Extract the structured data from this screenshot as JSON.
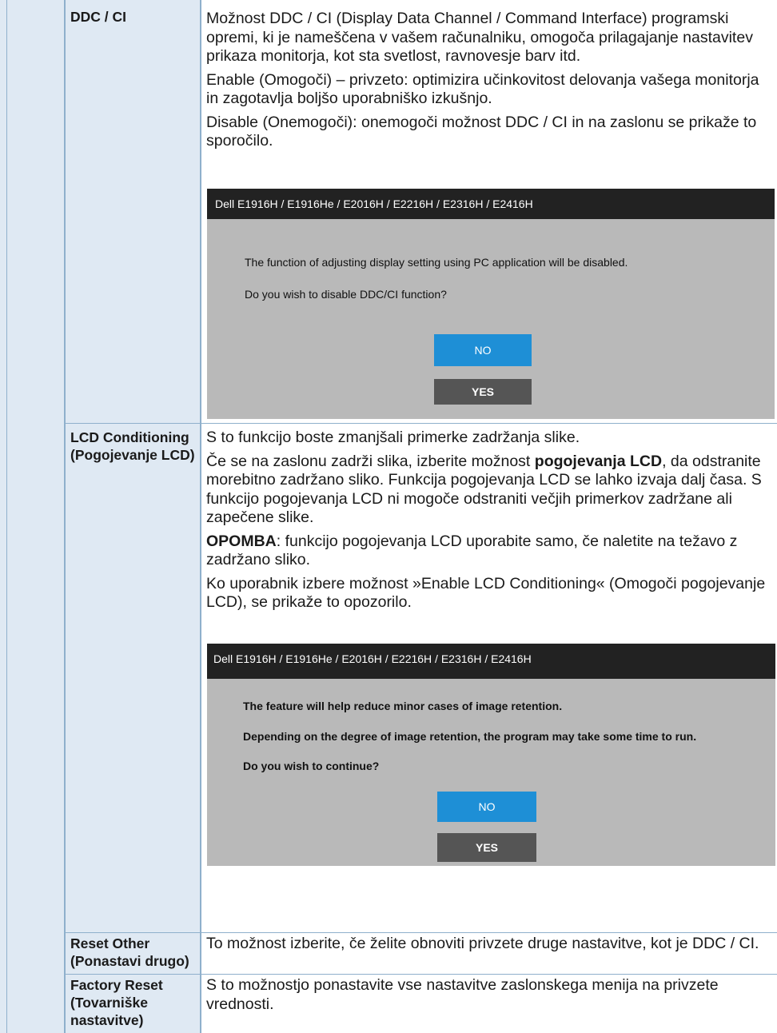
{
  "rows": [
    {
      "name": "DDC / CI",
      "paragraphs": [
        "Možnost DDC / CI (Display Data Channel / Command Interface) programski opremi, ki je nameščena v vašem računalniku, omogoča prilagajanje nastavitev prikaza monitorja, kot sta svetlost, ravnovesje barv itd.",
        "Enable (Omogoči) – privzeto: optimizira učinkovitost delovanja vašega monitorja in zagotavlja boljšo uporabniško izkušnjo.",
        "Disable (Onemogoči): onemogoči možnost DDC / CI in na zaslonu se prikaže to sporočilo."
      ]
    },
    {
      "name": "LCD Conditioning (Pogojevanje LCD)",
      "p1": "S to funkcijo boste zmanjšali primerke zadržanja slike.",
      "p2_before": "Če se na zaslonu zadrži slika, izberite možnost ",
      "p2_bold": "pogojevanja LCD",
      "p2_after": ", da odstranite morebitno zadržano sliko. Funkcija pogojevanja LCD se lahko izvaja dalj časa. S funkcijo pogojevanja LCD ni mogoče odstraniti večjih primerkov zadržane ali zapečene slike.",
      "p3_bold": "OPOMBA",
      "p3_after": ": funkcijo pogojevanja LCD uporabite samo, če naletite na težavo z zadržano sliko.",
      "p4": "Ko uporabnik izbere možnost »Enable LCD Conditioning« (Omogoči pogojevanje LCD), se prikaže to opozorilo."
    },
    {
      "name": "Reset Other (Ponastavi drugo)",
      "paragraph": "To možnost izberite, če želite obnoviti privzete druge nastavitve, kot je DDC / CI."
    },
    {
      "name": "Factory Reset (Tovarniške nastavitve)",
      "paragraph": "S to možnostjo ponastavite vse nastavitve zaslonskega menija na privzete vrednosti."
    }
  ],
  "dialog1": {
    "title": "Dell  E1916H / E1916He / E2016H / E2216H / E2316H  / E2416H",
    "line1": "The function of adjusting display setting using PC application will be disabled.",
    "line2": "Do you wish to disable DDC/CI function?",
    "no": "NO",
    "yes": "YES"
  },
  "dialog2": {
    "title": "Dell  E1916H / E1916He / E2016H / E2216H / E2316H  / E2416H",
    "line1": "The feature will help reduce minor cases of image retention.",
    "line2": "Depending on the degree of image retention, the program may take some time to run.",
    "line3": "Do you wish to continue?",
    "no": "NO",
    "yes": "YES"
  },
  "colors": {
    "table_border": "#8fb0cc",
    "name_cell_bg": "#dfe9f3",
    "dialog_bg": "#b9b9b9",
    "dialog_titlebar": "#222222",
    "no_button": "#1e8fd6",
    "yes_button": "#555555"
  }
}
